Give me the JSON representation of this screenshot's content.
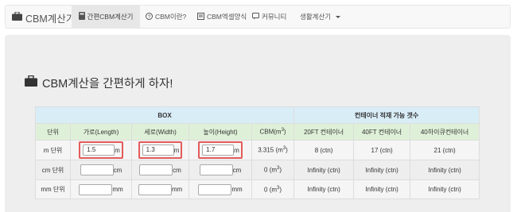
{
  "navbar": {
    "brand": "CBM계산기",
    "items": [
      {
        "label": "간편CBM계산기"
      },
      {
        "label": "CBM이란?"
      },
      {
        "label": "CBM엑셀양식"
      },
      {
        "label": "커뮤니티"
      },
      {
        "label": "생활계산기"
      }
    ]
  },
  "headline": "CBM계산을 간편하게 하자!",
  "table": {
    "group_box": "BOX",
    "group_container": "컨테이너 적재 가능 갯수",
    "columns": [
      "단위",
      "가로(Length)",
      "세로(Width)",
      "높이(Height)",
      "CBM(m",
      "20FT 컨테이너",
      "40FT 컨테이너",
      "40하이큐컨테이너"
    ],
    "cbm_sup": "3",
    "cbm_close": ")",
    "rows": [
      {
        "unit": "m 단위",
        "length": "1.5",
        "width": "1.3",
        "height": "1.7",
        "suffix": "m",
        "cbm": "3.315 (m",
        "cbm_sup": "3",
        "cbm_close": ")",
        "c20": "8 (ctn)",
        "c40": "17 (ctn)",
        "c40hq": "21 (ctn)"
      },
      {
        "unit": "cm 단위",
        "length": "",
        "width": "",
        "height": "",
        "suffix": "cm",
        "cbm": "0 (m",
        "cbm_sup": "3",
        "cbm_close": ")",
        "c20": "Infinity (ctn)",
        "c40": "Infinity (ctn)",
        "c40hq": "Infinity (ctn)"
      },
      {
        "unit": "mm 단위",
        "length": "",
        "width": "",
        "height": "",
        "suffix": "mm",
        "cbm": "0 (m",
        "cbm_sup": "3",
        "cbm_close": ")",
        "c20": "Infinity (ctn)",
        "c40": "Infinity (ctn)",
        "c40hq": "Infinity (ctn)"
      }
    ]
  },
  "colors": {
    "navbar_bg": "#f8f8f8",
    "jumbotron_bg": "#eeeeee",
    "header_blue": "#d9edf7",
    "header_green": "#dff0d8",
    "highlight_red": "#e45b5b"
  },
  "icons": {
    "brand": "briefcase-icon",
    "calculator": "calculator-icon",
    "question": "question-circle-icon",
    "spreadsheet": "list-alt-icon",
    "community": "comment-icon",
    "dropdown": "caret-down-icon"
  }
}
